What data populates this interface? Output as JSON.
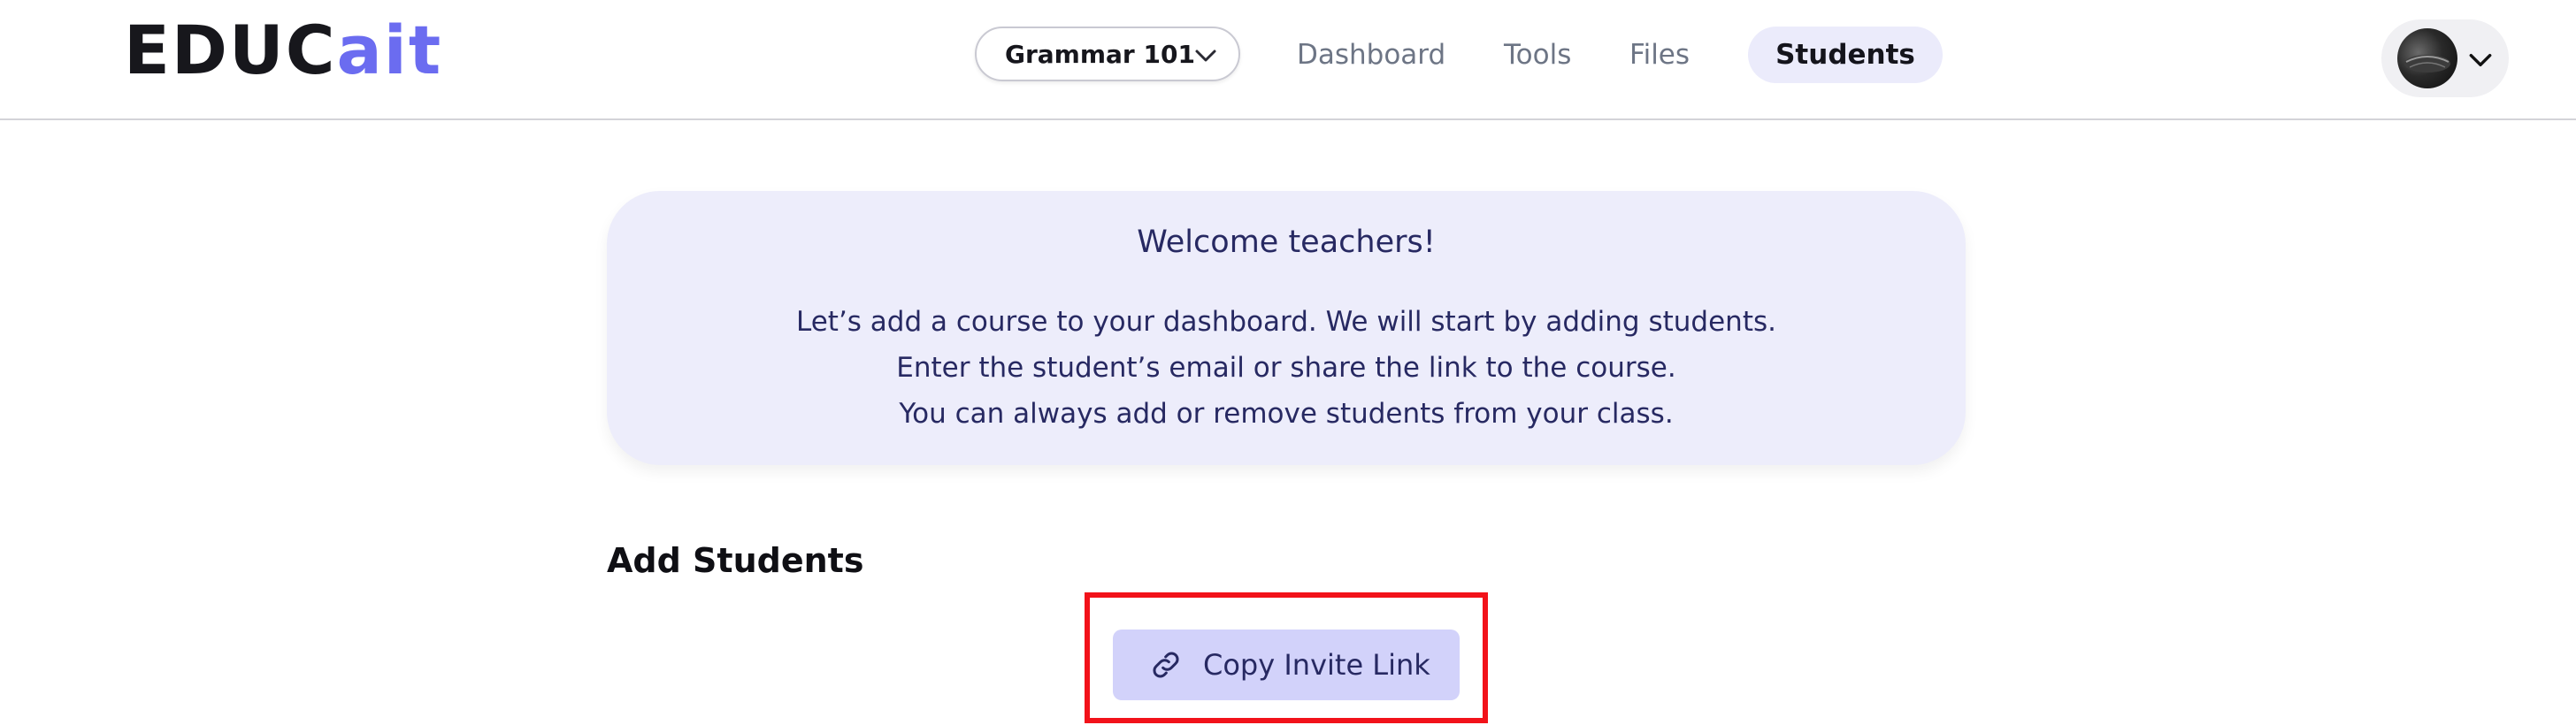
{
  "header": {
    "logo": {
      "main": "EDUC",
      "accent": "ait"
    },
    "course_select": {
      "value": "Grammar 101",
      "icon": "chevron-down-icon"
    },
    "nav": [
      {
        "label": "Dashboard",
        "active": false
      },
      {
        "label": "Tools",
        "active": false
      },
      {
        "label": "Files",
        "active": false
      },
      {
        "label": "Students",
        "active": true
      }
    ],
    "user_menu": {
      "icon": "chevron-down-icon"
    }
  },
  "welcome": {
    "title": "Welcome teachers!",
    "lines": [
      "Let’s add a course to your dashboard. We will start by adding students.",
      "Enter the student’s email or share the link to the course.",
      "You can always add or remove students from your class."
    ]
  },
  "add_students": {
    "heading": "Add Students",
    "copy_button": {
      "label": "Copy Invite Link",
      "icon": "link-icon"
    }
  },
  "colors": {
    "accent": "#6b6cf0",
    "card_bg": "#ededfb",
    "button_bg": "#d2d2fa",
    "text_dark_blue": "#272962",
    "highlight": "#f2121a"
  }
}
